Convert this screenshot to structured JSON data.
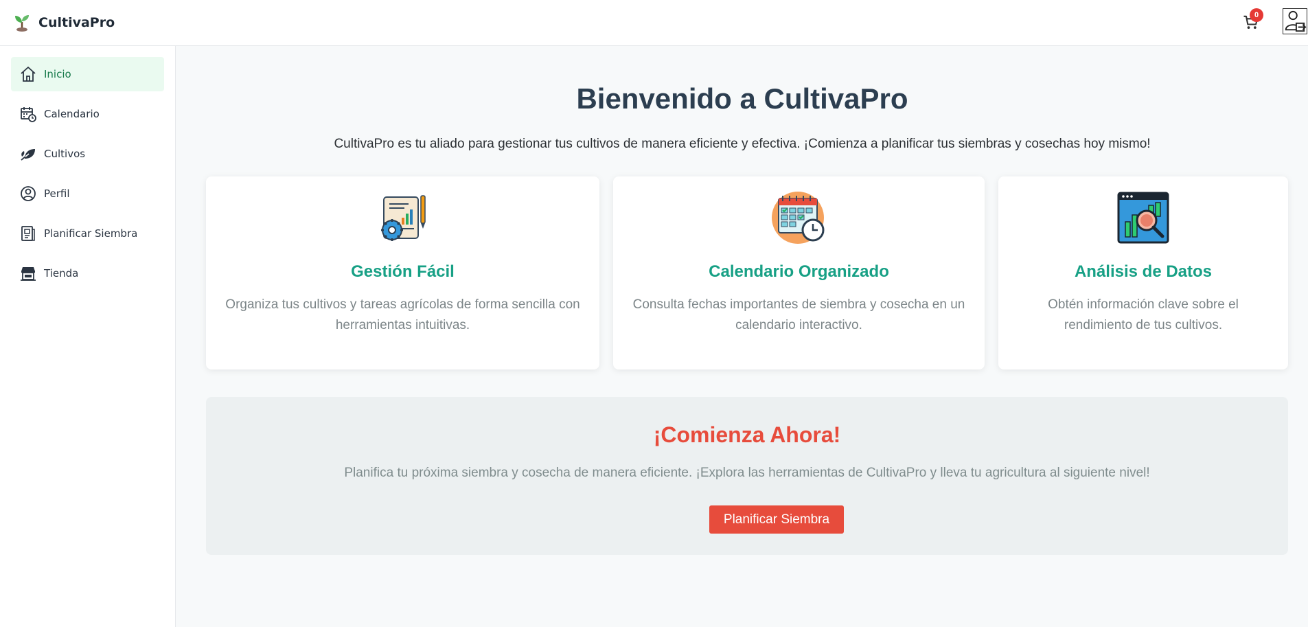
{
  "header": {
    "brand": "CultivaPro",
    "cart_count": "0"
  },
  "sidebar": {
    "items": [
      {
        "label": "Inicio",
        "icon": "home-icon",
        "active": true
      },
      {
        "label": "Calendario",
        "icon": "calendar-icon",
        "active": false
      },
      {
        "label": "Cultivos",
        "icon": "leaf-icon",
        "active": false
      },
      {
        "label": "Perfil",
        "icon": "user-circle-icon",
        "active": false
      },
      {
        "label": "Planificar Siembra",
        "icon": "document-icon",
        "active": false
      },
      {
        "label": "Tienda",
        "icon": "store-icon",
        "active": false
      }
    ]
  },
  "hero": {
    "title": "Bienvenido a CultivaPro",
    "subtitle": "CultivaPro es tu aliado para gestionar tus cultivos de manera eficiente y efectiva. ¡Comienza a planificar tus siembras y cosechas hoy mismo!"
  },
  "features": [
    {
      "title": "Gestión Fácil",
      "text": "Organiza tus cultivos y tareas agrícolas de forma sencilla con herramientas intuitivas.",
      "icon": "report-gear-icon"
    },
    {
      "title": "Calendario Organizado",
      "text": "Consulta fechas importantes de siembra y cosecha en un calendario interactivo.",
      "icon": "calendar-clock-icon"
    },
    {
      "title": "Análisis de Datos",
      "text": "Obtén información clave sobre el rendimiento de tus cultivos.",
      "icon": "chart-magnifier-icon"
    }
  ],
  "cta": {
    "title": "¡Comienza Ahora!",
    "text": "Planifica tu próxima siembra y cosecha de manera eficiente. ¡Explora las herramientas de CultivaPro y lleva tu agricultura al siguiente nivel!",
    "button": "Planificar Siembra"
  },
  "colors": {
    "accent_green": "#17a085",
    "cta_red": "#e74c3c",
    "active_nav_bg": "#eafaf0",
    "heading": "#2c3e50"
  }
}
